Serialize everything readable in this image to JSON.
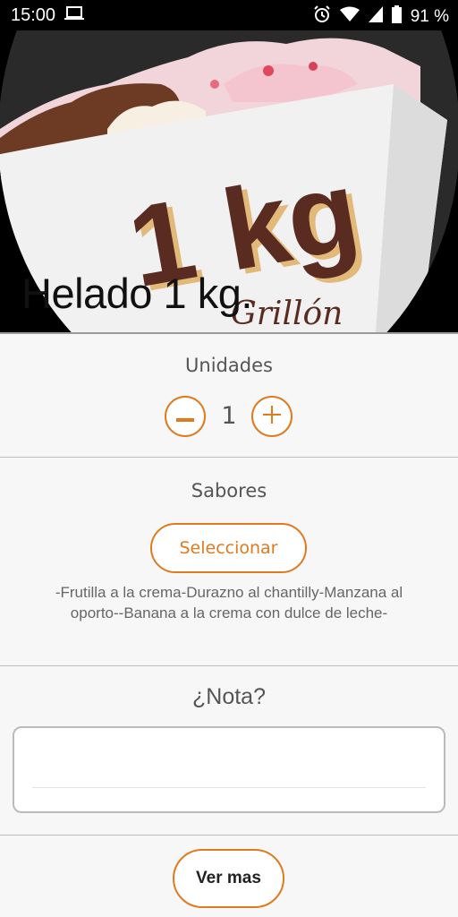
{
  "status_bar": {
    "time": "15:00",
    "battery": "91 %",
    "icons": [
      "laptop-icon",
      "alarm-icon",
      "wifi-icon",
      "signal-icon",
      "battery-icon"
    ]
  },
  "product": {
    "title": "Helado 1 kg.",
    "image_text": "1 kg",
    "image_brand_text": "Grillón"
  },
  "units": {
    "label": "Unidades",
    "value": "1",
    "icons": [
      "minus-icon",
      "plus-icon"
    ]
  },
  "flavors": {
    "label": "Sabores",
    "select_label": "Seleccionar",
    "list_text": "-Frutilla a la crema-Durazno al chantilly-Manzana al oporto--Banana a la crema con dulce de leche-"
  },
  "note": {
    "label": "¿Nota?",
    "value": ""
  },
  "actions": {
    "more_label": "Ver mas"
  },
  "colors": {
    "accent": "#e07a1f",
    "background": "#f7f7f7",
    "text_muted": "#555555"
  }
}
